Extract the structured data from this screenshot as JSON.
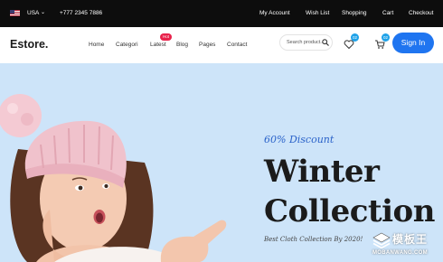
{
  "colors": {
    "topbar_bg": "#0d0d0d",
    "accent_blue": "#1f75f0",
    "badge_red": "#e8224b",
    "count_badge": "#1fa2e8",
    "hero_bg": "#cde4f9",
    "discount_text": "#2a62c9"
  },
  "topbar": {
    "flag_icon": "us-flag-icon",
    "language": "USA",
    "language_chevron": "⌄",
    "phone": "+777 2345 7886",
    "links": [
      "My Account",
      "Wish List",
      "Shopping",
      "Cart",
      "Checkout"
    ]
  },
  "navbar": {
    "logo": "Estore.",
    "menu": [
      "Home",
      "Categori",
      "Latest",
      "Blog",
      "Pages",
      "Contact"
    ],
    "new_badge": "Hot",
    "search": {
      "placeholder": "Search product...",
      "icon": "search-icon"
    },
    "wishlist": {
      "icon": "heart-icon",
      "count": "02"
    },
    "cart": {
      "icon": "cart-icon",
      "count": "02"
    },
    "signin_label": "Sign In"
  },
  "hero": {
    "discount": "60% Discount",
    "headline_line1": "Winter",
    "headline_line2": "Collection",
    "subtitle": "Best Cloth Collection By 2020!",
    "image": "girl-in-pink-knit-hat-pointing"
  },
  "watermark": {
    "chinese_text": "模板王",
    "domain": "MOBANWANG.COM"
  }
}
